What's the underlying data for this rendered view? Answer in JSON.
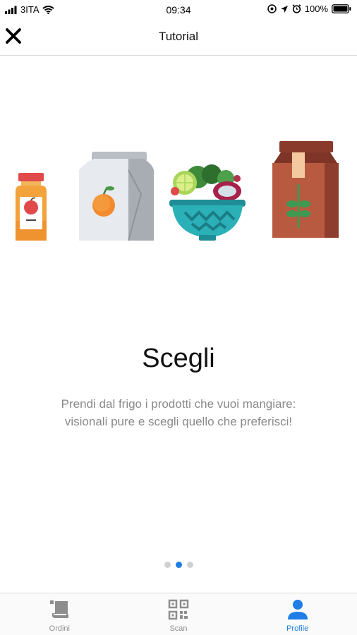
{
  "status_bar": {
    "carrier": "3ITA",
    "time": "09:34",
    "battery": "100%"
  },
  "nav": {
    "title": "Tutorial",
    "close_icon": "close-icon"
  },
  "slide": {
    "title": "Scegli",
    "description_line1": "Prendi dal frigo i prodotti che vuoi mangiare:",
    "description_line2": "visionali pure e scegli quello che preferisci!",
    "illustrations": [
      "juice-bottle-icon",
      "orange-bag-icon",
      "salad-bowl-icon",
      "grain-carton-icon"
    ]
  },
  "pager": {
    "count": 3,
    "active_index": 1
  },
  "tab_bar": {
    "tabs": [
      {
        "label": "Ordini",
        "icon": "receipt-icon",
        "active": false
      },
      {
        "label": "Scan",
        "icon": "qr-code-icon",
        "active": false
      },
      {
        "label": "Profile",
        "icon": "user-icon",
        "active": true
      }
    ]
  },
  "colors": {
    "accent": "#1e7ee6",
    "inactive": "#8e8e8e",
    "description": "#8a8a8a"
  }
}
